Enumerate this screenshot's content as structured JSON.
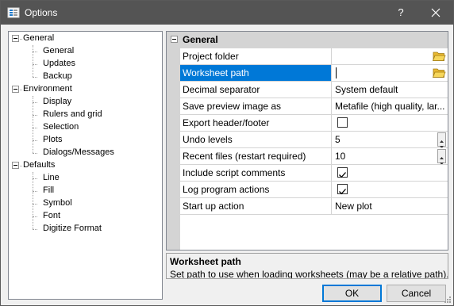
{
  "window": {
    "title": "Options",
    "help_label": "?"
  },
  "tree": {
    "groups": [
      {
        "label": "General",
        "children": [
          "General",
          "Updates",
          "Backup"
        ]
      },
      {
        "label": "Environment",
        "children": [
          "Display",
          "Rulers and grid",
          "Selection",
          "Plots",
          "Dialogs/Messages"
        ]
      },
      {
        "label": "Defaults",
        "children": [
          "Line",
          "Fill",
          "Symbol",
          "Font",
          "Digitize Format"
        ]
      }
    ]
  },
  "grid": {
    "category": "General",
    "rows": [
      {
        "name": "Project folder",
        "value": "",
        "editor": "folder"
      },
      {
        "name": "Worksheet path",
        "value": "",
        "editor": "folder",
        "selected": true
      },
      {
        "name": "Decimal separator",
        "value": "System default",
        "editor": "text"
      },
      {
        "name": "Save preview image as",
        "value": "Metafile (high quality, lar...",
        "editor": "text"
      },
      {
        "name": "Export header/footer",
        "value": "",
        "editor": "checkbox",
        "checked": false
      },
      {
        "name": "Undo levels",
        "value": "5",
        "editor": "spinner"
      },
      {
        "name": "Recent files (restart required)",
        "value": "10",
        "editor": "spinner"
      },
      {
        "name": "Include script comments",
        "value": "",
        "editor": "checkbox",
        "checked": true
      },
      {
        "name": "Log program actions",
        "value": "",
        "editor": "checkbox",
        "checked": true
      },
      {
        "name": "Start up action",
        "value": "New plot",
        "editor": "text"
      }
    ]
  },
  "description": {
    "title": "Worksheet path",
    "text": "Set path to use when loading worksheets (may be a relative path)."
  },
  "buttons": {
    "ok": "OK",
    "cancel": "Cancel"
  },
  "colors": {
    "titlebar": "#545454",
    "selection": "#0078d7",
    "category_band": "#d4d4d4"
  }
}
